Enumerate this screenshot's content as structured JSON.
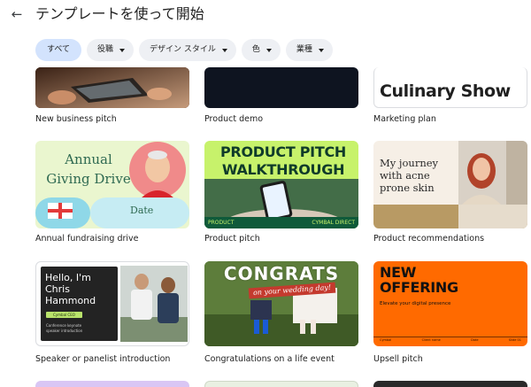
{
  "header": {
    "title": "テンプレートを使って開始"
  },
  "filters": [
    {
      "label": "すべて"
    },
    {
      "label": "役職"
    },
    {
      "label": "デザイン スタイル"
    },
    {
      "label": "色"
    },
    {
      "label": "業種"
    }
  ],
  "templates": {
    "business_pitch": {
      "caption": "New business pitch"
    },
    "product_demo": {
      "caption": "Product demo"
    },
    "marketing_plan": {
      "caption": "Marketing plan",
      "thumb_title": "Culinary Show"
    },
    "annual_fundraising": {
      "caption": "Annual fundraising drive",
      "thumb_title": "Annual Giving Drive",
      "thumb_date": "Date"
    },
    "product_pitch": {
      "caption": "Product pitch",
      "thumb_title": "PRODUCT PITCH WALKTHROUGH",
      "thumb_foot_left": "PRODUCT",
      "thumb_foot_right": "CYMBAL DIRECT"
    },
    "product_recommendations": {
      "caption": "Product recommendations",
      "thumb_title": "My journey with acne prone skin"
    },
    "speaker_intro": {
      "caption": "Speaker or panelist introduction",
      "thumb_title": "Hello, I'm Chris Hammond",
      "thumb_tag": "Cymbal CEO",
      "thumb_sub": "Conference keynote speaker introduction"
    },
    "congratulations": {
      "caption": "Congratulations on a life event",
      "thumb_title": "CONGRATS",
      "thumb_sub": "on your wedding day!"
    },
    "upsell_pitch": {
      "caption": "Upsell pitch",
      "thumb_title": "NEW OFFERING",
      "thumb_sub": "Elevate your digital presence",
      "thumb_foot": [
        "Cymbal",
        "Client name",
        "Date",
        "Slide 01"
      ]
    }
  },
  "colors": {
    "chip_active": "#d3e3fd",
    "chip": "#eef0f4",
    "pitch_green": "#c7f26b",
    "upsell_orange": "#ff6a00"
  }
}
